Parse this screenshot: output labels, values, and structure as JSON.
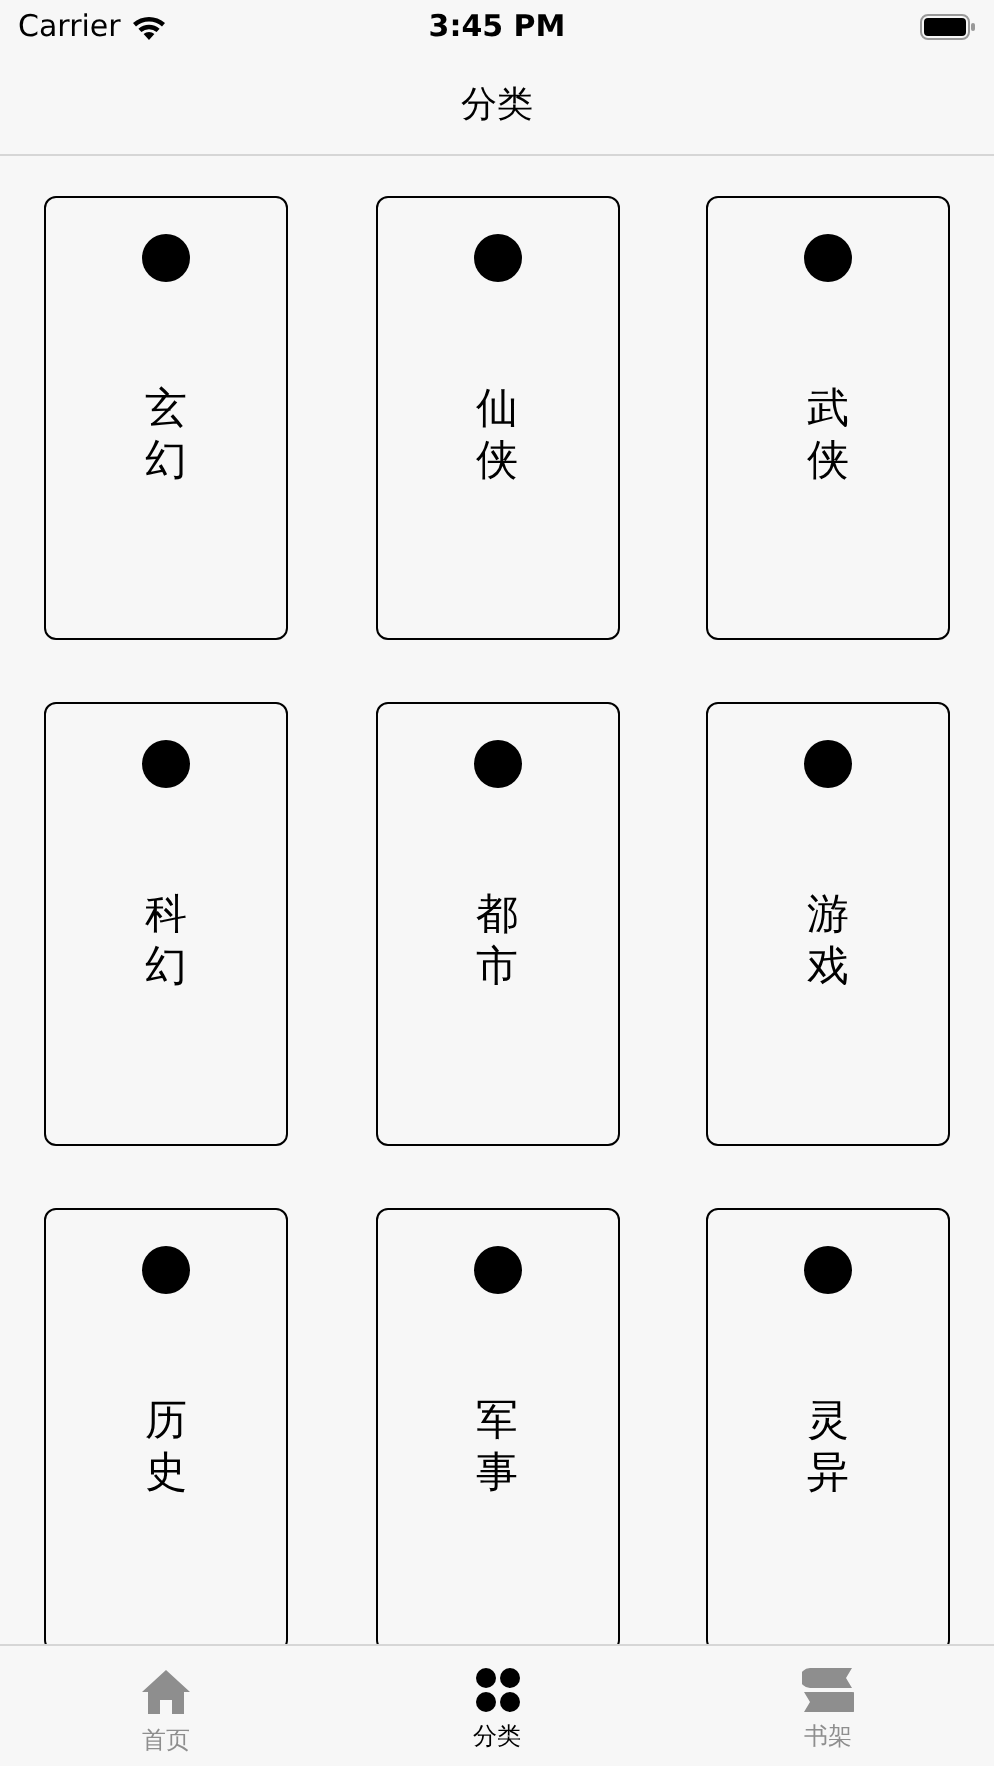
{
  "status_bar": {
    "carrier": "Carrier",
    "time": "3:45 PM"
  },
  "nav": {
    "title": "分类"
  },
  "categories": [
    {
      "label": "玄幻"
    },
    {
      "label": "仙侠"
    },
    {
      "label": "武侠"
    },
    {
      "label": "科幻"
    },
    {
      "label": "都市"
    },
    {
      "label": "游戏"
    },
    {
      "label": "历史"
    },
    {
      "label": "军事"
    },
    {
      "label": "灵异"
    }
  ],
  "tab_bar": [
    {
      "kind": "home",
      "label": "首页",
      "selected": false
    },
    {
      "kind": "grid",
      "label": "分类",
      "selected": true
    },
    {
      "kind": "shelf",
      "label": "书架",
      "selected": false
    }
  ]
}
